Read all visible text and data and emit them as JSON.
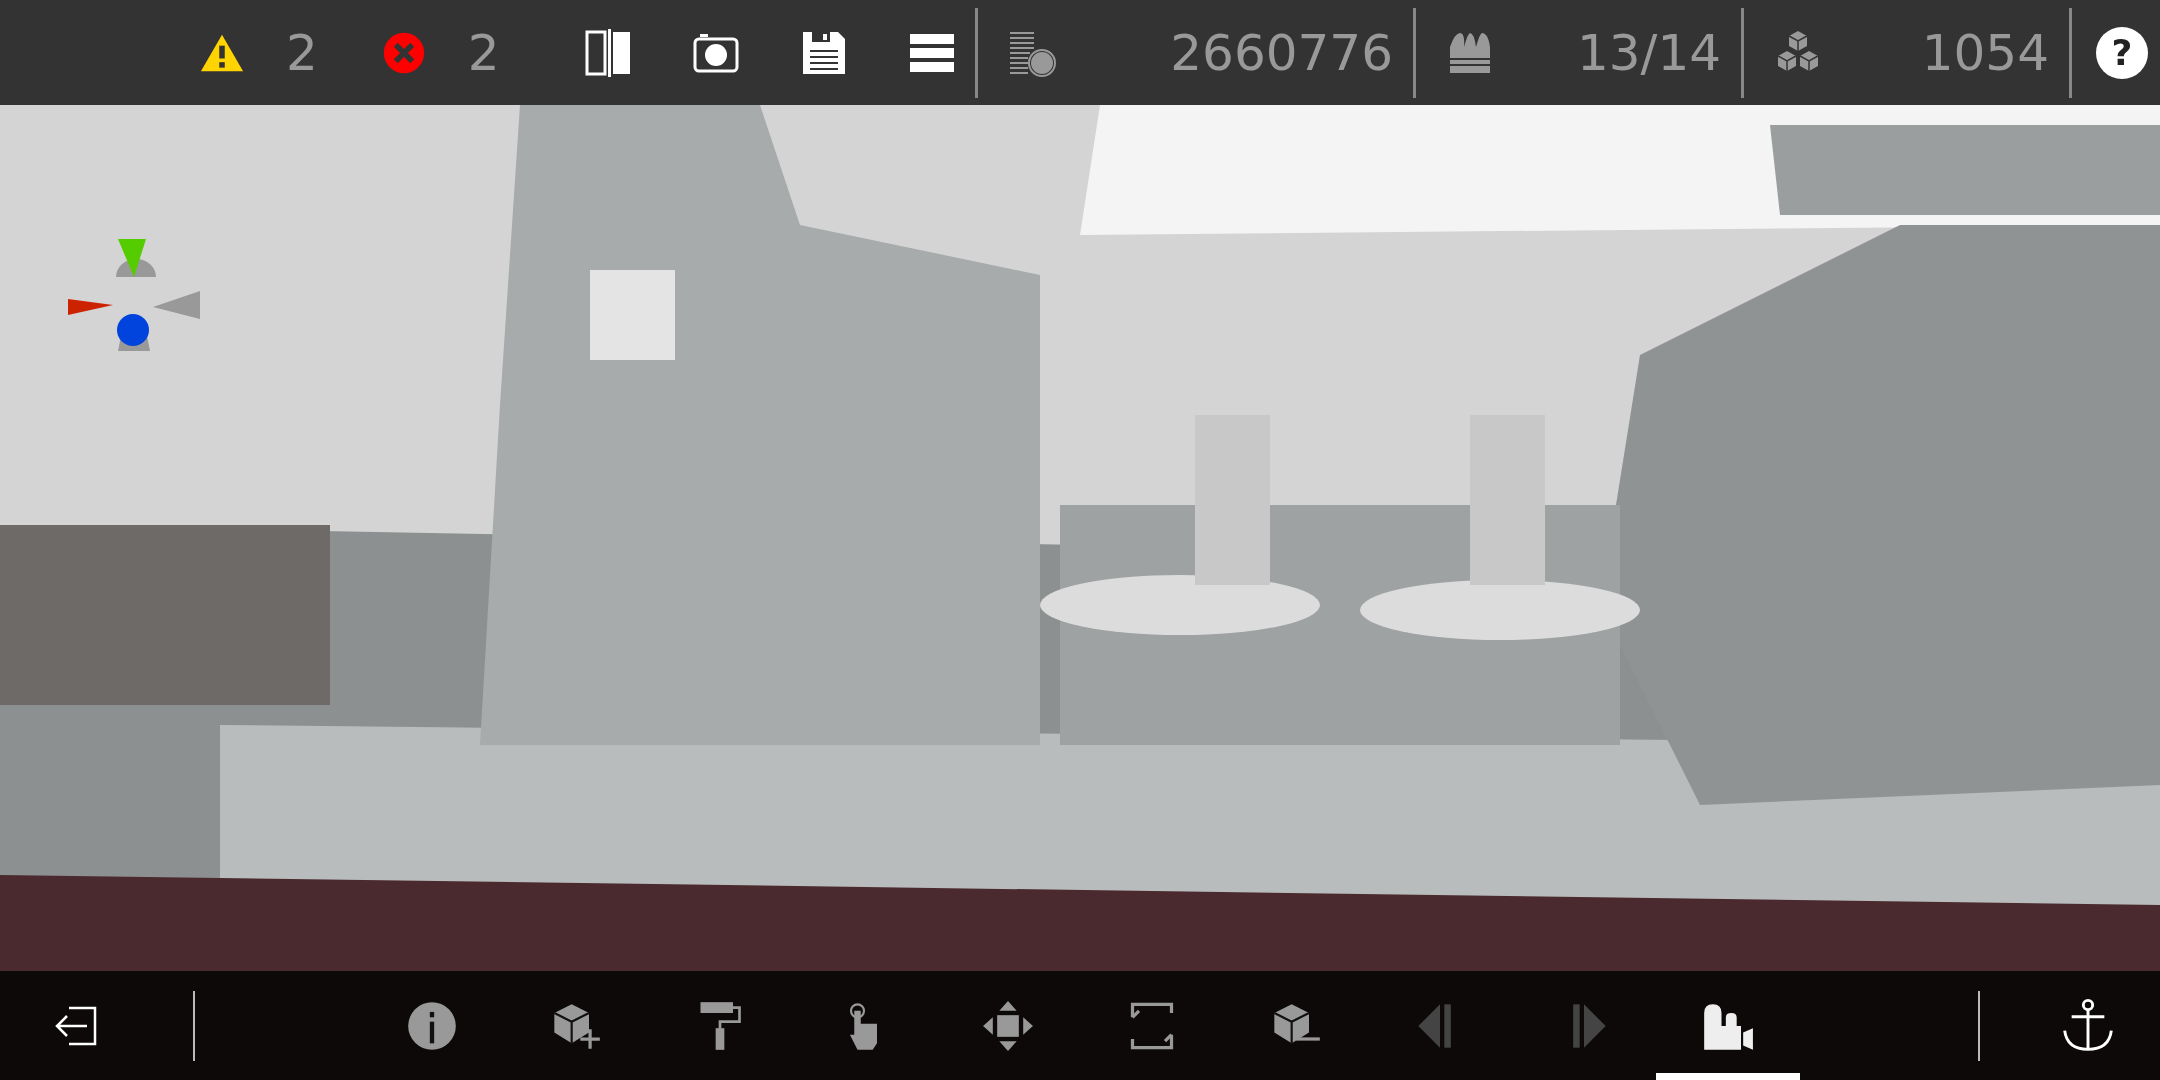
{
  "status_bar": {
    "counters": [
      {
        "kind": "warning",
        "count": "2"
      },
      {
        "kind": "error",
        "count": "2"
      }
    ],
    "stats": [
      {
        "kind": "polygons",
        "value": "2660776"
      },
      {
        "kind": "ammo",
        "value": "13/14"
      },
      {
        "kind": "parts",
        "value": "1054"
      }
    ],
    "help": "?"
  },
  "toolbar": {
    "tools": [
      {
        "kind": "info",
        "selected": false,
        "disabled": false
      },
      {
        "kind": "add",
        "selected": false,
        "disabled": false
      },
      {
        "kind": "paint",
        "selected": false,
        "disabled": false
      },
      {
        "kind": "select",
        "selected": false,
        "disabled": false
      },
      {
        "kind": "move",
        "selected": false,
        "disabled": false
      },
      {
        "kind": "resize",
        "selected": false,
        "disabled": false
      },
      {
        "kind": "remove",
        "selected": false,
        "disabled": false
      },
      {
        "kind": "prev",
        "selected": false,
        "disabled": true
      },
      {
        "kind": "next",
        "selected": false,
        "disabled": true
      },
      {
        "kind": "scene",
        "selected": true,
        "disabled": false
      }
    ]
  }
}
